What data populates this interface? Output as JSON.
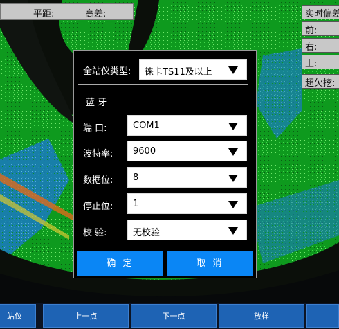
{
  "topbar": {
    "pingju": "平距:",
    "gaocha": "高差:"
  },
  "right_panel": {
    "header": "实时偏差",
    "qian": "前:",
    "you": "右:",
    "shang": "上:",
    "chaoqianwa": "超欠挖:"
  },
  "dialog": {
    "station_type_label": "全站仪类型:",
    "station_type_value": "徕卡TS11及以上",
    "bluetooth_heading": "蓝  牙",
    "port_label": "端  口:",
    "port_value": "COM1",
    "baud_label": "波特率:",
    "baud_value": "9600",
    "databits_label": "数据位:",
    "databits_value": "8",
    "stopbits_label": "停止位:",
    "stopbits_value": "1",
    "parity_label": "校  验:",
    "parity_value": "无校验",
    "confirm_label": "确 定",
    "cancel_label": "取 消"
  },
  "bottom_bar": {
    "station": "站仪",
    "prev": "上一点",
    "next": "下一点",
    "stakeout": "放样"
  },
  "colors": {
    "accent": "#0a86f5",
    "bottom_button": "#1e63b4"
  }
}
